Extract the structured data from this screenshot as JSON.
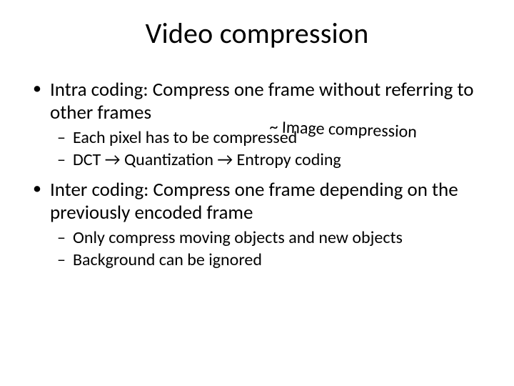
{
  "title": "Video compression",
  "bullets": {
    "b1": "Intra coding: Compress one frame without referring to other frames",
    "b1s1": "Each pixel has to be compressed",
    "b1s2": "DCT → Quantization → Entropy coding",
    "b2": "Inter coding: Compress one frame depending on the previously encoded frame",
    "b2s1": "Only compress moving objects and new objects",
    "b2s2": "Background can be ignored"
  },
  "annotation": "~ Image compression"
}
